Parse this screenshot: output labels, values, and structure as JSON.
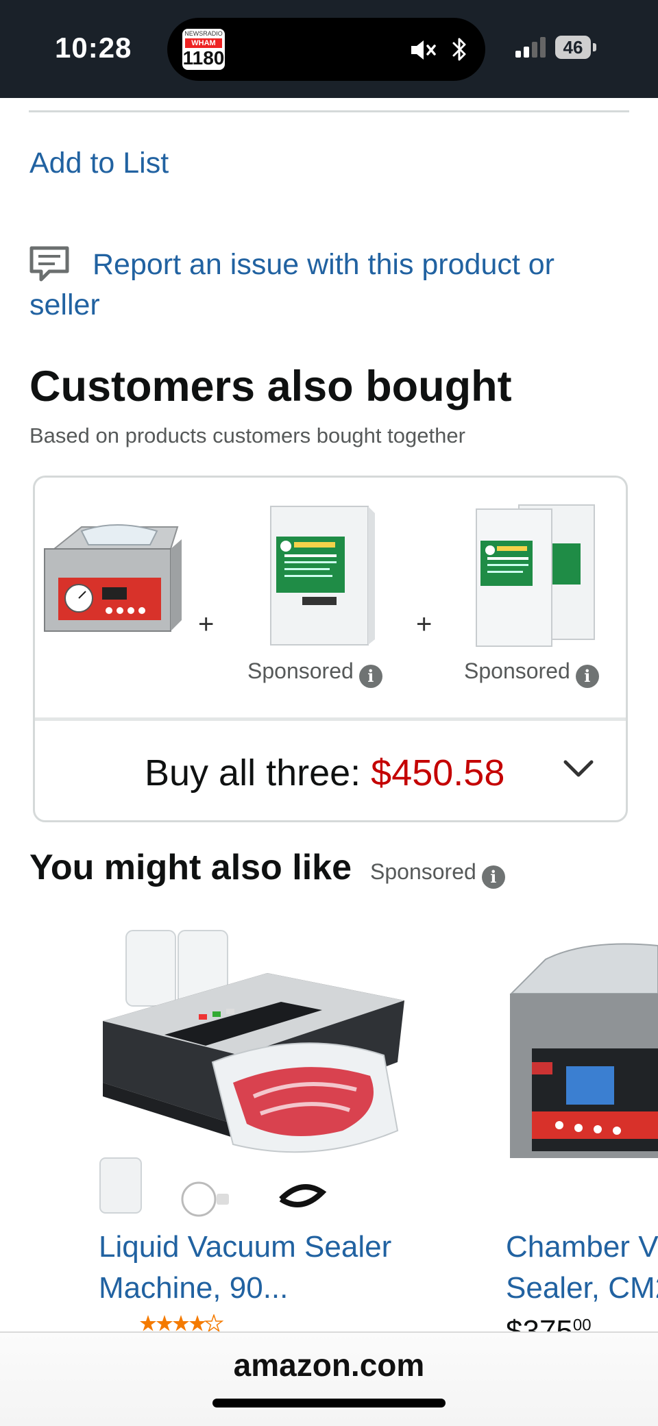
{
  "status_bar": {
    "time": "10:28",
    "radio_logo": {
      "line1": "NEWSRADIO",
      "line2": "WHAM",
      "line3": "1180"
    },
    "battery": "46",
    "icons": [
      "mute-icon",
      "bluetooth-icon",
      "signal-icon",
      "battery-icon"
    ]
  },
  "actions": {
    "add_to_list": "Add to List",
    "report": "Report an issue with this product or seller"
  },
  "customers_also_bought": {
    "heading": "Customers also bought",
    "subheading": "Based on products customers bought together",
    "plus_1": "+",
    "plus_2": "+",
    "sponsored_1": "Sponsored",
    "sponsored_2": "Sponsored",
    "buy_all_label": "Buy all three: ",
    "buy_all_price": "$450.58"
  },
  "you_might_also_like": {
    "heading": "You might also like",
    "sponsored": "Sponsored",
    "cards": [
      {
        "title_line1": "Liquid Vacuum Sealer",
        "title_line2": "Machine, 90...",
        "rating": 4.5
      },
      {
        "title_line1": "Chamber V",
        "title_line2": "Sealer, CM2",
        "price": "$375.00",
        "price_display": "$375",
        "price_cents": "00"
      }
    ]
  },
  "bottom_bar": {
    "domain": "amazon.com"
  },
  "colors": {
    "link": "#2162a1",
    "price_red": "#c40000",
    "status_bg": "#1a2129",
    "star": "#f47a00"
  }
}
